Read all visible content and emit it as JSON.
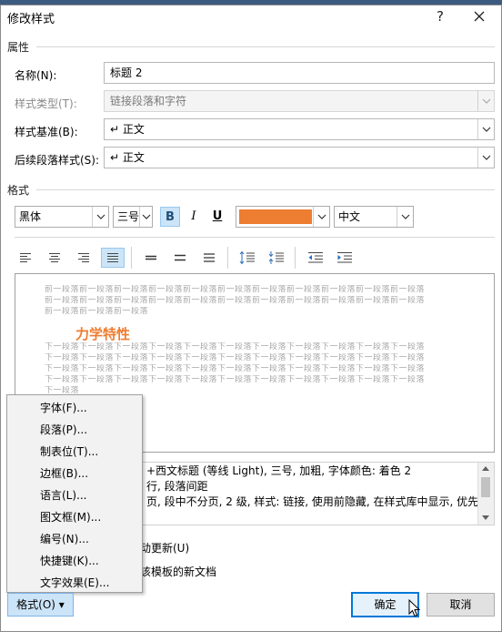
{
  "dialog": {
    "title": "修改样式",
    "help_icon": "question-mark",
    "close_icon": "close-x"
  },
  "properties": {
    "section_label": "属性",
    "name_label": "名称(N):",
    "name_value": "标题 2",
    "style_type_label": "样式类型(T):",
    "style_type_value": "链接段落和字符",
    "based_on_label": "样式基准(B):",
    "based_on_value": "↵ 正文",
    "next_style_label": "后续段落样式(S):",
    "next_style_value": "↵ 正文"
  },
  "format": {
    "section_label": "格式",
    "font_value": "黑体",
    "size_value": "三号",
    "bold": "B",
    "italic": "I",
    "underline": "U",
    "color_value": "#ed7d31",
    "script_value": "中文",
    "bold_active": true,
    "justify_active": true
  },
  "preview": {
    "prev_para": "前一段落前一段落前一段落前一段落前一段落前一段落前一段落前一段落前一段落前一段落前一段落前一段落前一段落前一段落前一段落前一段落前一段落前一段落前一段落前一段落前一段落前一段落前一段落",
    "prev_line1": "前一段落前一段落前一段落前一段落前一段落前一段落前一段落前一段落前一段落前一段落前一段落",
    "prev_line2": "前一段落前一段落前一段落前一段落前一段落前一段落前一段落前一段落前一段落前一段落前一段落",
    "prev_line3": "前一段落前一段落前一段落",
    "sample_text": "力学特性",
    "next_line1": "下一段落下一段落下一段落下一段落下一段落下一段落下一段落下一段落下一段落下一段落下一段落",
    "next_line2": "下一段落下一段落下一段落下一段落下一段落下一段落下一段落下一段落下一段落下一段落下一段落",
    "next_line3": "下一段落下一段落下一段落下一段落下一段落下一段落下一段落下一段落下一段落下一段落下一段落",
    "next_line4": "下一段落下一段落下一段落下一段落下一段落下一段落下一段落下一段落下一段落下一段落下一段落",
    "next_line5": "下一段落"
  },
  "description": {
    "line1": "+西文标题 (等线 Light), 三号, 加粗, 字体颜色: 着色 2",
    "line2": "行, 段落间距",
    "line3": "页, 段中不分页, 2 级, 样式: 链接, 使用前隐藏, 在样式库中显示, 优先"
  },
  "options": {
    "auto_update_label": "动更新(U)",
    "new_docs_label": "该模板的新文档"
  },
  "menu": {
    "items": [
      "字体(F)...",
      "段落(P)...",
      "制表位(T)...",
      "边框(B)...",
      "语言(L)...",
      "图文框(M)...",
      "编号(N)...",
      "快捷键(K)...",
      "文字效果(E)..."
    ]
  },
  "footer": {
    "format_button": "格式(O) ▾",
    "ok_button": "确定",
    "cancel_button": "取消"
  }
}
